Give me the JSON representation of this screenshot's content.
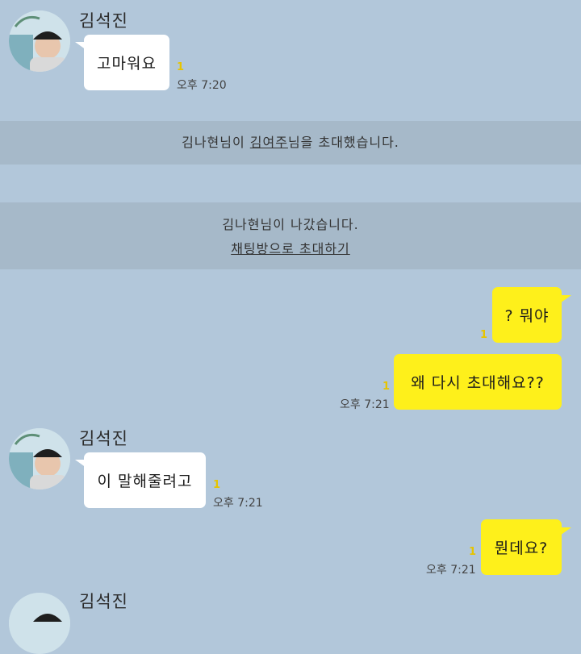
{
  "messages": [
    {
      "sender": "김석진",
      "text": "고마워요",
      "unread": "1",
      "time": "오후 7:20"
    },
    {
      "text": "? 뭐야",
      "unread": "1"
    },
    {
      "text": "왜 다시 초대해요??",
      "unread": "1",
      "time": "오후 7:21"
    },
    {
      "sender": "김석진",
      "text": "이 말해줄려고",
      "unread": "1",
      "time": "오후 7:21"
    },
    {
      "text": "뭔데요?",
      "unread": "1",
      "time": "오후 7:21"
    },
    {
      "sender": "김석진"
    }
  ],
  "notices": {
    "invite": {
      "prefix": "김나현님이 ",
      "invitee": "김여주",
      "suffix": "님을 초대했습니다."
    },
    "left": {
      "text": "김나현님이 나갔습니다.",
      "link": "채팅방으로 초대하기"
    }
  },
  "colors": {
    "background": "#b2c7da",
    "my_bubble": "#fef01b",
    "their_bubble": "#ffffff",
    "notice_band": "#a6b9c9"
  }
}
